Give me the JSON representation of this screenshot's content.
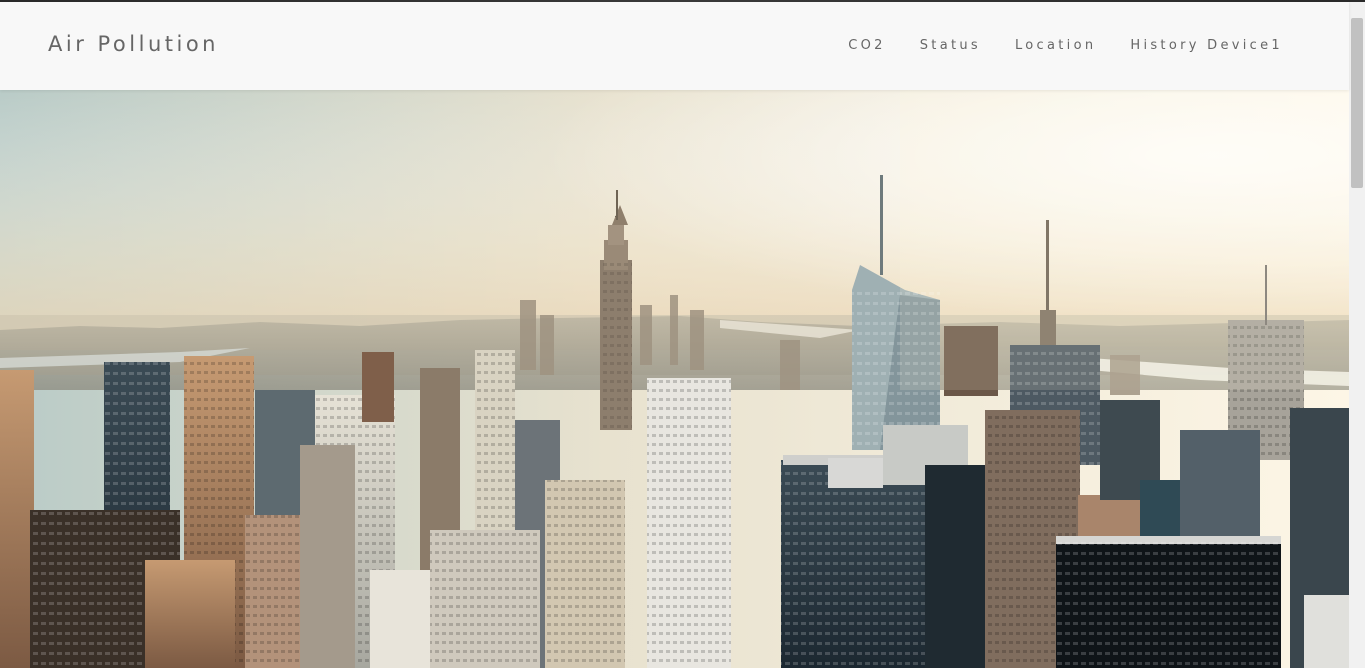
{
  "navbar": {
    "brand": "Air Pollution",
    "links": [
      {
        "label": "CO2"
      },
      {
        "label": "Status"
      },
      {
        "label": "Location"
      },
      {
        "label": "History Device1"
      }
    ]
  },
  "hero": {
    "image": "city-skyline-photo",
    "colors": {
      "sky_top": "#c9d6d2",
      "sky_glow": "#fbf1da",
      "haze": "#e9dcc4",
      "buildings_dark": "#2a3a44",
      "buildings_warm": "#b8865f"
    }
  },
  "scrollbar": {
    "visible": true
  }
}
